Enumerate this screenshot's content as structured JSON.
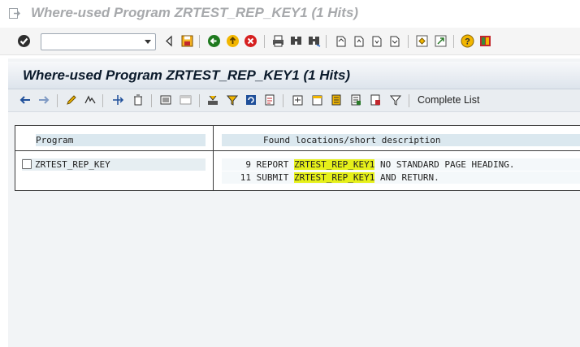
{
  "window": {
    "title": "Where-used Program ZRTEST_REP_KEY1 (1 Hits)",
    "icon": "exit-window-icon"
  },
  "system_toolbar": {
    "enter_icon": "green-check-icon",
    "command_field": {
      "value": "",
      "placeholder": ""
    },
    "icons": [
      "collapse-left-icon",
      "save-icon",
      "back-icon",
      "exit-icon",
      "cancel-icon",
      "print-icon",
      "find-icon",
      "find-next-icon",
      "first-page-icon",
      "previous-page-icon",
      "next-page-icon",
      "last-page-icon",
      "create-session-icon",
      "shortcut-icon",
      "help-icon",
      "layout-icon"
    ]
  },
  "screen": {
    "title": "Where-used Program ZRTEST_REP_KEY1 (1 Hits)",
    "app_toolbar": {
      "icons": [
        "back-arrow-icon",
        "forward-arrow-icon",
        "edit-pencil-icon",
        "display-change-icon",
        "navigate-icon",
        "delete-icon",
        "list-icon",
        "window-icon",
        "print-icon",
        "filter-icon",
        "refresh-icon",
        "export-icon",
        "select-all-icon",
        "select-block-icon",
        "details-icon",
        "details2-icon",
        "delete-mark-icon",
        "set-filter-icon"
      ],
      "complete_list_label": "Complete List"
    }
  },
  "results": {
    "columns": [
      "Program",
      "Found locations/short description"
    ],
    "programs": [
      {
        "name": "ZRTEST_REP_KEY",
        "checked": false
      }
    ],
    "hits": [
      {
        "line": "9",
        "before": "REPORT ",
        "highlight": "ZRTEST_REP_KEY1",
        "after": " NO STANDARD PAGE HEADING."
      },
      {
        "line": "11",
        "before": "SUBMIT ",
        "highlight": "ZRTEST_REP_KEY1",
        "after": " AND RETURN."
      }
    ],
    "highlight_color": "#e6f019"
  }
}
